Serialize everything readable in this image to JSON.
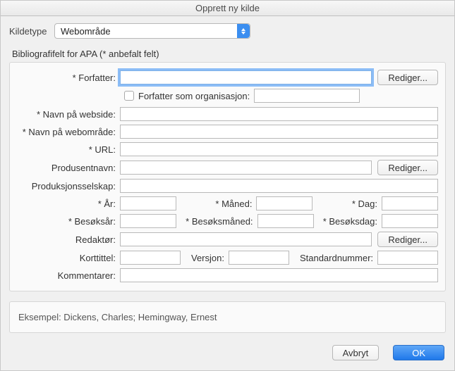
{
  "title": "Opprett ny kilde",
  "source_type": {
    "label": "Kildetype",
    "value": "Webområde"
  },
  "section_label": "Bibliografifelt for APA  (* anbefalt felt)",
  "labels": {
    "forfatter": "* Forfatter:",
    "forfatter_org": "Forfatter som organisasjon:",
    "navn_webside": "* Navn på webside:",
    "navn_webomrade": "* Navn på webområde:",
    "url": "* URL:",
    "produsentnavn": "Produsentnavn:",
    "produksjonsselskap": "Produksjonsselskap:",
    "aar": "* År:",
    "maaned": "* Måned:",
    "dag": "* Dag:",
    "besoksaar": "* Besøksår:",
    "besoksmaaned": "* Besøksmåned:",
    "besoksdag": "* Besøksdag:",
    "redaktor": "Redaktør:",
    "korttittel": "Korttittel:",
    "versjon": "Versjon:",
    "standardnummer": "Standardnummer:",
    "kommentarer": "Kommentarer:"
  },
  "buttons": {
    "rediger": "Rediger...",
    "avbryt": "Avbryt",
    "ok": "OK"
  },
  "example": "Eksempel: Dickens, Charles; Hemingway, Ernest"
}
